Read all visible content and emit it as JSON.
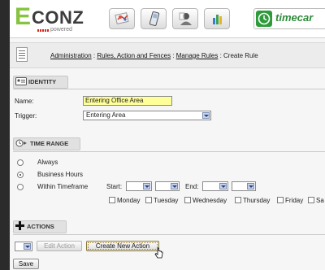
{
  "header": {
    "logo_e": "E",
    "logo_conz": "CONZ",
    "logo_powered": "powered",
    "timecard_label": "timecar"
  },
  "breadcrumb": {
    "items": [
      "Administration",
      "Rules, Action and Fences",
      "Manage Rules"
    ],
    "separator": " : ",
    "current": "Create Rule"
  },
  "identity": {
    "section_title": "IDENTITY",
    "name_label": "Name:",
    "name_value": "Entering Office Area",
    "trigger_label": "Trigger:",
    "trigger_value": "Entering Area"
  },
  "time_range": {
    "section_title": "TIME RANGE",
    "options": [
      "Always",
      "Business Hours",
      "Within Timeframe"
    ],
    "selected": "Business Hours",
    "start_label": "Start:",
    "end_label": "End:",
    "days": [
      "Monday",
      "Tuesday",
      "Wednesday",
      "Thursday",
      "Friday",
      "Sa"
    ]
  },
  "actions": {
    "section_title": "ACTIONS",
    "edit_button": "Edit Action",
    "create_button": "Create New Action"
  },
  "save_button": "Save",
  "colors": {
    "name_highlight": "#ffff99",
    "logo_green": "#86c440",
    "timecard_green": "#2e8b3a"
  }
}
